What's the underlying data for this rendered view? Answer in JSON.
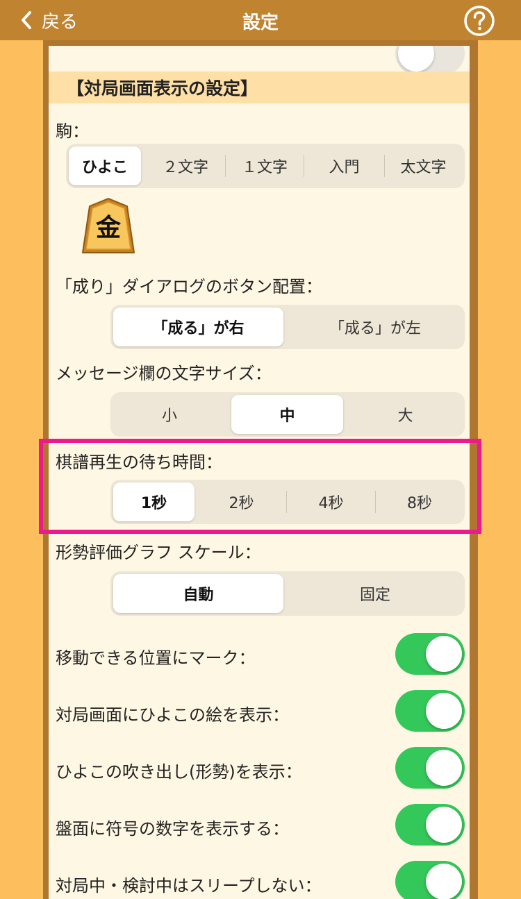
{
  "header": {
    "back_label": "戻る",
    "title": "設定",
    "help_icon": "question-circle-icon"
  },
  "section": {
    "title": "【対局画面表示の設定】"
  },
  "koma": {
    "label": "駒：",
    "options": [
      "ひよこ",
      "２文字",
      "１文字",
      "入門",
      "太文字"
    ],
    "selected": "ひよこ",
    "preview_char": "金"
  },
  "nari": {
    "label": "「成り」ダイアログのボタン配置：",
    "options": [
      "「成る」が右",
      "「成る」が左"
    ],
    "selected": "「成る」が右"
  },
  "message_size": {
    "label": "メッセージ欄の文字サイズ：",
    "options": [
      "小",
      "中",
      "大"
    ],
    "selected": "中"
  },
  "replay_wait": {
    "label": "棋譜再生の待ち時間：",
    "options": [
      "1秒",
      "2秒",
      "4秒",
      "8秒"
    ],
    "selected": "1秒"
  },
  "graph_scale": {
    "label": "形勢評価グラフ スケール：",
    "options": [
      "自動",
      "固定"
    ],
    "selected": "自動"
  },
  "toggles": [
    {
      "label": "移動できる位置にマーク：",
      "on": true
    },
    {
      "label": "対局画面にひよこの絵を表示：",
      "on": true
    },
    {
      "label": "ひよこの吹き出し(形勢)を表示：",
      "on": true
    },
    {
      "label": "盤面に符号の数字を表示する：",
      "on": true
    },
    {
      "label": "対局中・検討中はスリープしない：",
      "on": true
    }
  ],
  "colors": {
    "header": "#C0832F",
    "background": "#FDBE5E",
    "panel": "#FEF7E3",
    "section_header": "#FEDFA5",
    "toggle_on": "#34C759",
    "highlight": "#EC1A8D"
  }
}
